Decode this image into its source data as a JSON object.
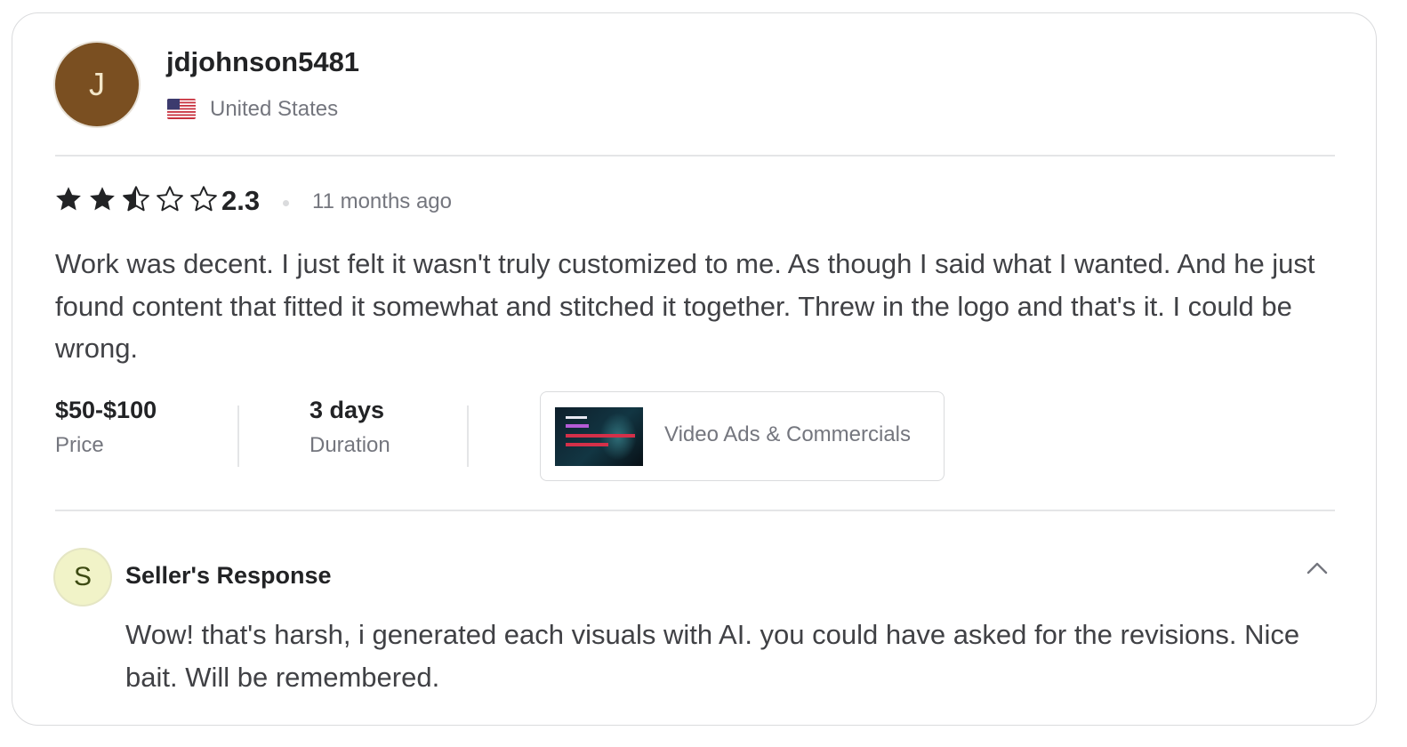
{
  "reviewer": {
    "avatar_initial": "J",
    "username": "jdjohnson5481",
    "country": "United States",
    "flag_icon": "us-flag-icon"
  },
  "review": {
    "rating_value": 2.3,
    "rating_label": "2.3",
    "stars_total": 5,
    "time": "11 months ago",
    "text": "Work was decent. I just felt it wasn't truly customized to me. As though I said what I wanted. And he just found content that fitted it somewhat and stitched it together. Threw in the logo and that's it. I could be wrong."
  },
  "meta": {
    "price_value": "$50-$100",
    "price_label": "Price",
    "duration_value": "3 days",
    "duration_label": "Duration"
  },
  "gig": {
    "title": "Video Ads & Commercials"
  },
  "seller_response": {
    "avatar_initial": "S",
    "title": "Seller's Response",
    "text": "Wow! that's harsh, i generated each visuals with AI. you could have asked for the revisions. Nice bait. Will be remembered.",
    "toggle_icon": "chevron-up-icon"
  },
  "colors": {
    "avatar_bg": "#7a4f21",
    "seller_avatar_bg": "#f1f3c8",
    "star": "#222325",
    "text_primary": "#222325",
    "text_secondary": "#74767e"
  }
}
